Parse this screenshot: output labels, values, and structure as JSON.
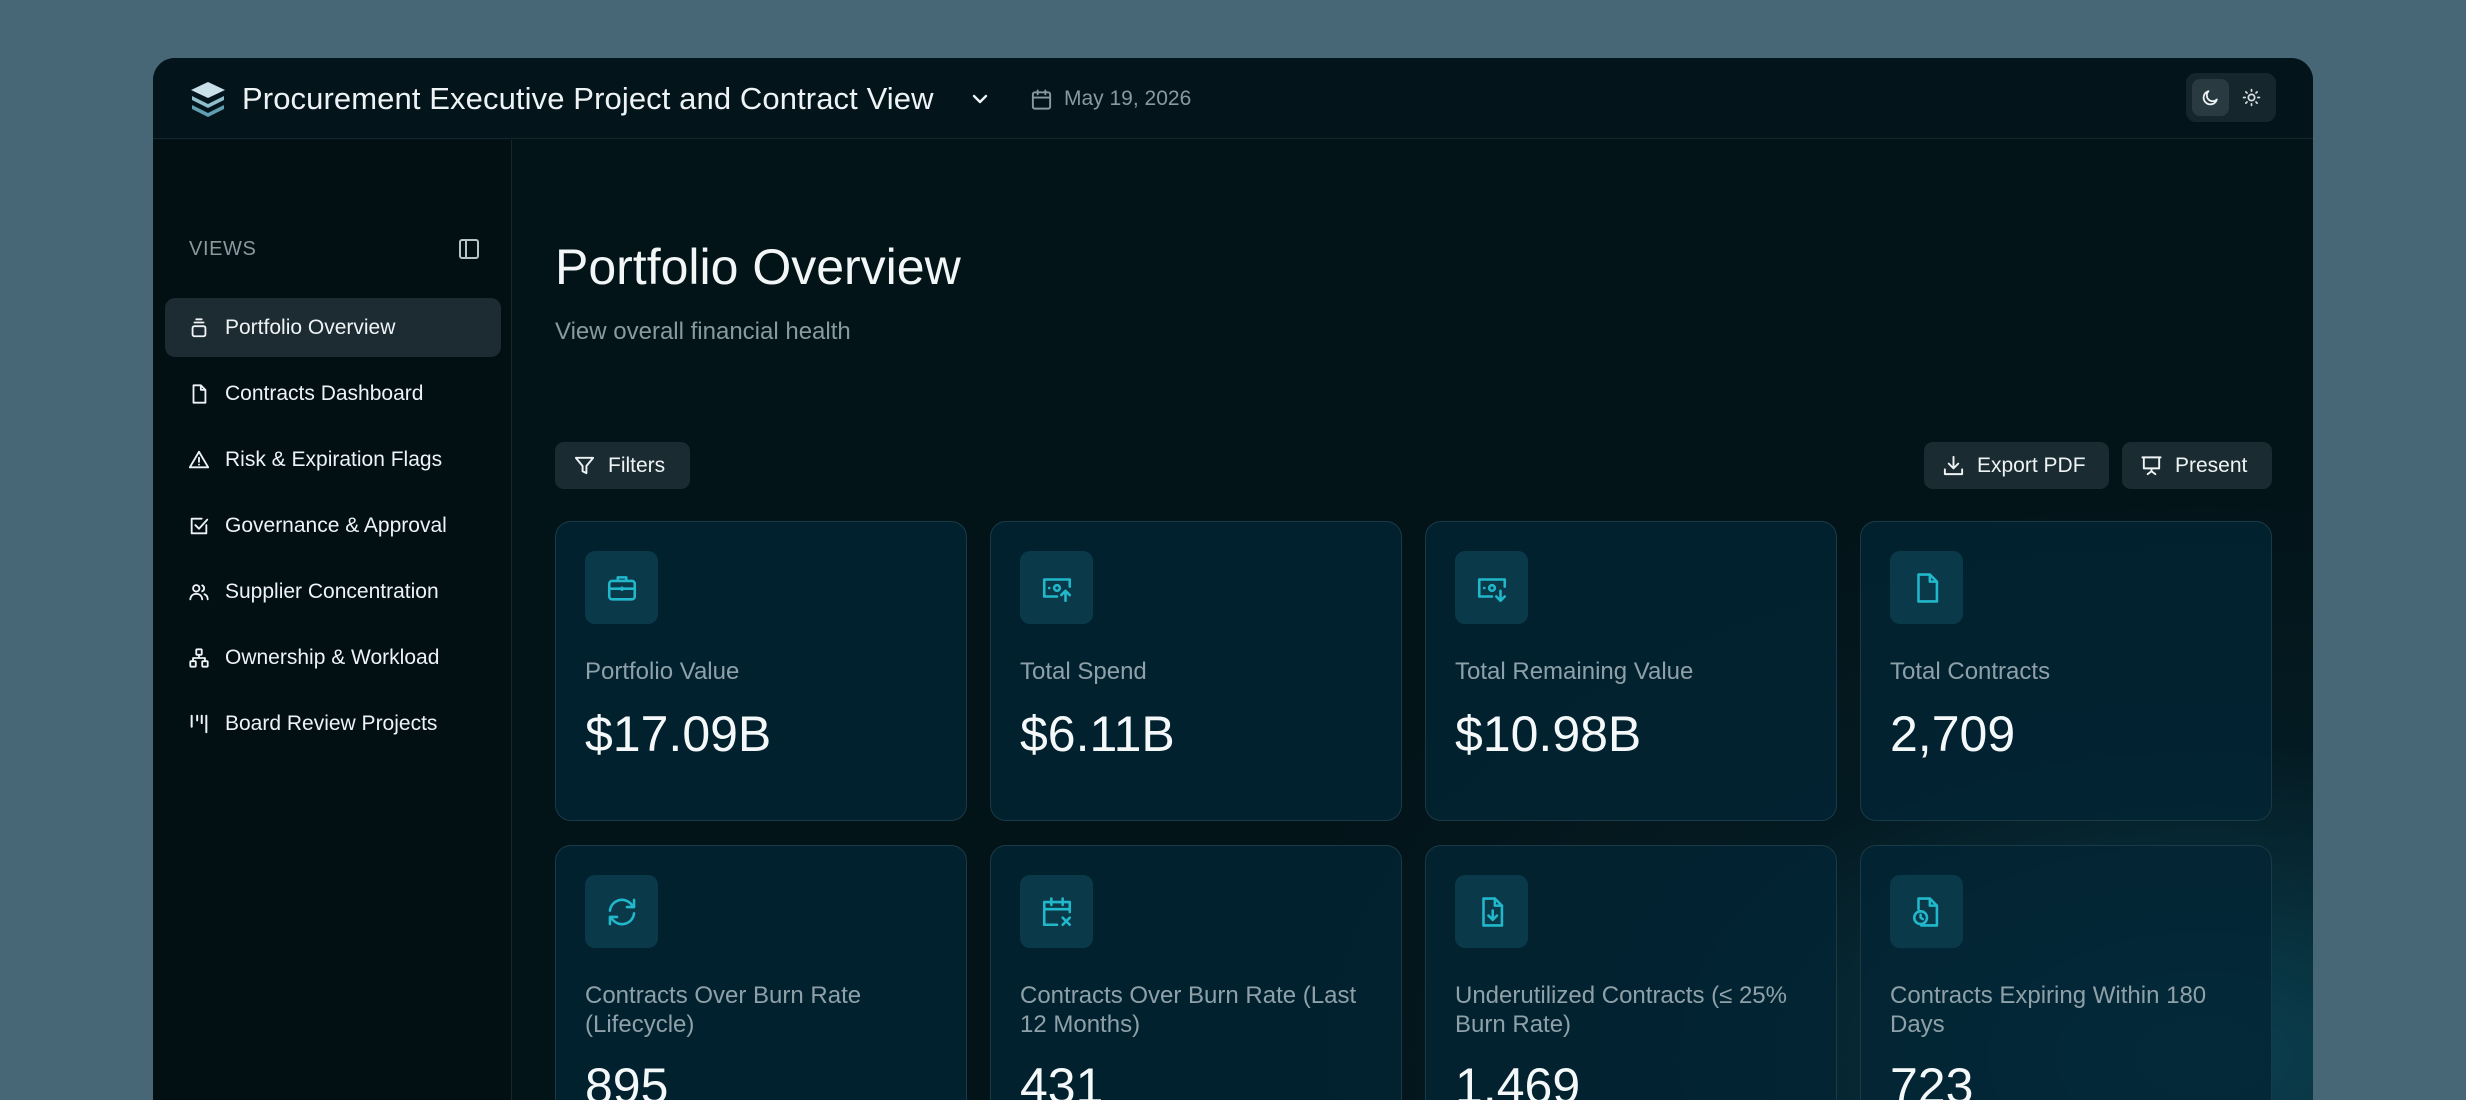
{
  "app": {
    "title": "Procurement Executive Project and Contract View",
    "date": "May 19, 2026"
  },
  "sidebar": {
    "section_label": "VIEWS",
    "items": [
      {
        "label": "Portfolio Overview",
        "icon": "layers-icon",
        "active": true
      },
      {
        "label": "Contracts Dashboard",
        "icon": "file-icon"
      },
      {
        "label": "Risk & Expiration Flags",
        "icon": "alert-triangle-icon"
      },
      {
        "label": "Governance & Approval",
        "icon": "check-square-icon"
      },
      {
        "label": "Supplier Concentration",
        "icon": "users-icon"
      },
      {
        "label": "Ownership & Workload",
        "icon": "network-icon"
      },
      {
        "label": "Board Review Projects",
        "icon": "kanban-icon"
      }
    ]
  },
  "main": {
    "title": "Portfolio Overview",
    "subtitle": "View overall financial health",
    "filters_label": "Filters",
    "export_label": "Export PDF",
    "present_label": "Present"
  },
  "cards": [
    {
      "label": "Portfolio Value",
      "value": "$17.09B",
      "icon": "briefcase-icon"
    },
    {
      "label": "Total Spend",
      "value": "$6.11B",
      "icon": "money-up-icon"
    },
    {
      "label": "Total Remaining Value",
      "value": "$10.98B",
      "icon": "money-down-icon"
    },
    {
      "label": "Total Contracts",
      "value": "2,709",
      "icon": "file-icon"
    },
    {
      "label": "Contracts Over Burn Rate (Lifecycle)",
      "value": "895",
      "icon": "refresh-icon"
    },
    {
      "label": "Contracts Over Burn Rate (Last 12 Months)",
      "value": "431",
      "icon": "calendar-x-icon"
    },
    {
      "label": "Underutilized Contracts (≤ 25% Burn Rate)",
      "value": "1,469",
      "icon": "file-down-icon"
    },
    {
      "label": "Contracts Expiring Within 180 Days",
      "value": "723",
      "icon": "file-clock-icon"
    }
  ],
  "colors": {
    "accent": "#22b8cc",
    "background": "#031419",
    "card": "#022534"
  }
}
